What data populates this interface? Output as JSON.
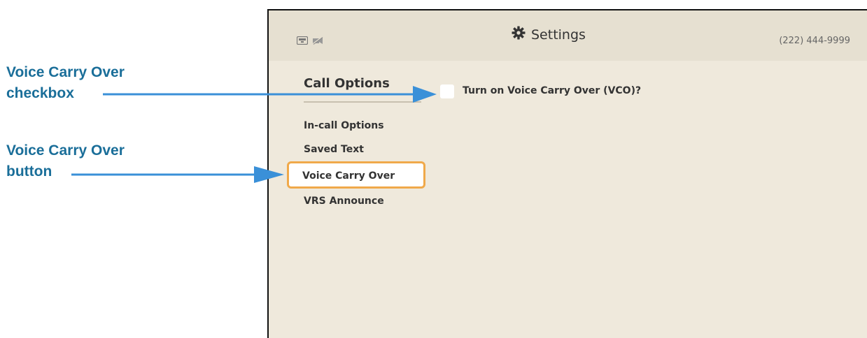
{
  "callouts": {
    "checkbox_label_line1": "Voice Carry Over",
    "checkbox_label_line2": "checkbox",
    "button_label_line1": "Voice Carry Over",
    "button_label_line2": "button"
  },
  "header": {
    "title": "Settings",
    "phone_number": "(222) 444-9999",
    "icons": [
      "network-icon",
      "camera-off-icon",
      "gear-icon"
    ]
  },
  "sidebar": {
    "section_title": "Call Options",
    "items": [
      {
        "label": "In-call Options",
        "selected": false
      },
      {
        "label": "Saved Text",
        "selected": false
      },
      {
        "label": "Voice Carry Over",
        "selected": true
      },
      {
        "label": "VRS Announce",
        "selected": false
      }
    ]
  },
  "main": {
    "vco_checkbox_label": "Turn on Voice Carry Over (VCO)?",
    "vco_checked": false
  },
  "colors": {
    "callout_text": "#1a6e99",
    "arrow": "#3a90d8",
    "selection_border": "#f0a94a",
    "screen_bg": "#efe9dc"
  }
}
